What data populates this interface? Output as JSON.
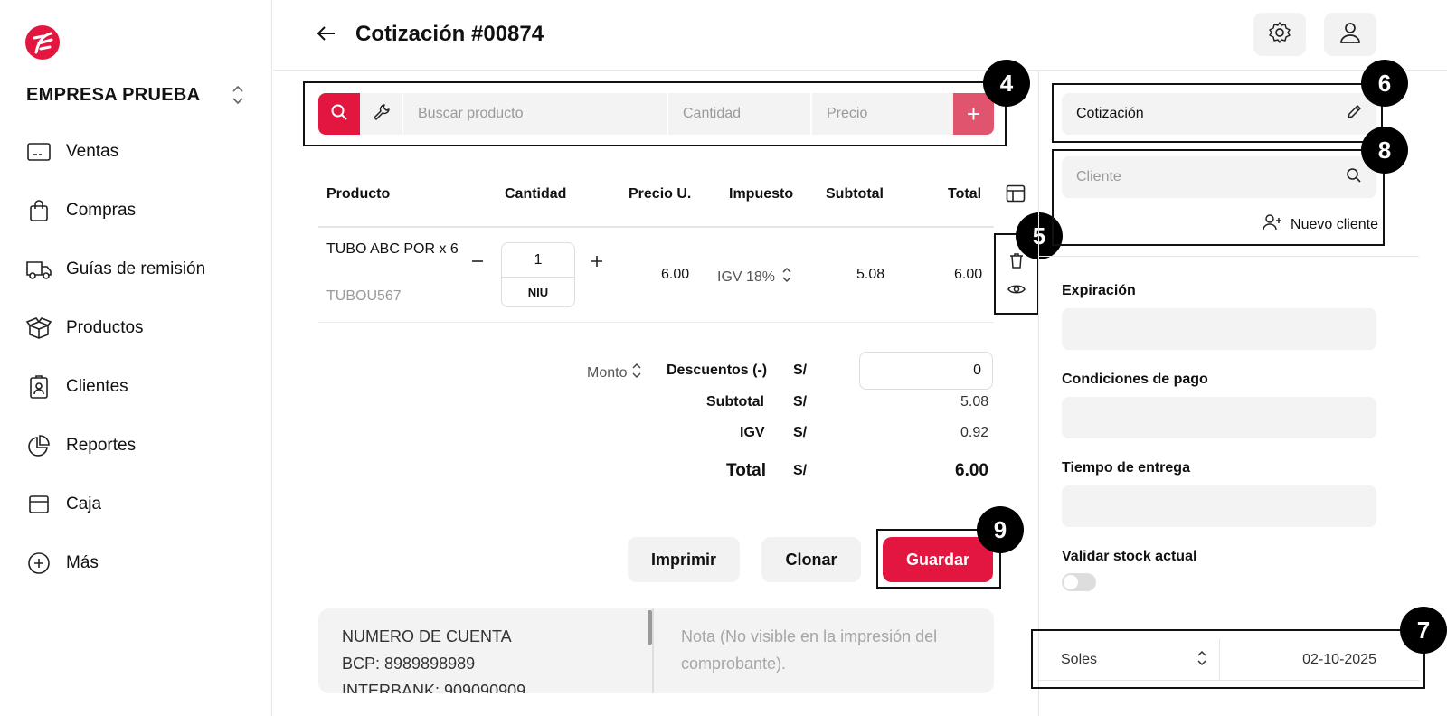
{
  "sidebar": {
    "company": "EMPRESA PRUEBA",
    "items": [
      {
        "label": "Ventas",
        "icon": "monitor-icon"
      },
      {
        "label": "Compras",
        "icon": "shopping-bag-icon"
      },
      {
        "label": "Guías de remisión",
        "icon": "truck-icon"
      },
      {
        "label": "Productos",
        "icon": "box-icon"
      },
      {
        "label": "Clientes",
        "icon": "id-badge-icon"
      },
      {
        "label": "Reportes",
        "icon": "pie-chart-icon"
      },
      {
        "label": "Caja",
        "icon": "cash-box-icon"
      },
      {
        "label": "Más",
        "icon": "plus-circle-icon"
      }
    ]
  },
  "header": {
    "title": "Cotización #00874"
  },
  "search": {
    "product_placeholder": "Buscar producto",
    "qty_placeholder": "Cantidad",
    "price_placeholder": "Precio",
    "add_label": "+"
  },
  "table": {
    "headers": [
      "Producto",
      "Cantidad",
      "Precio U.",
      "Impuesto",
      "Subtotal",
      "Total"
    ],
    "rows": [
      {
        "name": "TUBO ABC POR x 6",
        "code": "TUBOU567",
        "quantity": "1",
        "unit": "NIU",
        "unit_price": "6.00",
        "tax": "IGV 18%",
        "subtotal": "5.08",
        "total": "6.00"
      }
    ]
  },
  "totals": {
    "discount_mode": "Monto",
    "discount_label": "Descuentos (-)",
    "discount_value": "0",
    "subtotal_label": "Subtotal",
    "subtotal_value": "5.08",
    "igv_label": "IGV",
    "igv_value": "0.92",
    "total_label": "Total",
    "total_value": "6.00",
    "currency_symbol": "S/"
  },
  "actions": {
    "print": "Imprimir",
    "clone": "Clonar",
    "save": "Guardar"
  },
  "notes": {
    "bank_info": "NUMERO DE CUENTA\nBCP: 8989898989\nINTERBANK: 909090909",
    "note_placeholder": "Nota (No visible en la impresión del comprobante)."
  },
  "right_panel": {
    "doc_type": "Cotización",
    "client_placeholder": "Cliente",
    "new_client": "Nuevo cliente",
    "expiration_label": "Expiración",
    "payment_terms_label": "Condiciones de pago",
    "delivery_time_label": "Tiempo de entrega",
    "validate_stock_label": "Validar stock actual",
    "validate_stock_on": false,
    "currency": "Soles",
    "date": "02-10-2025"
  },
  "badges": [
    "4",
    "5",
    "6",
    "7",
    "8",
    "9"
  ],
  "colors": {
    "accent": "#e3163f",
    "accent_light": "#e0546e",
    "field_bg": "#f3f3f3"
  }
}
